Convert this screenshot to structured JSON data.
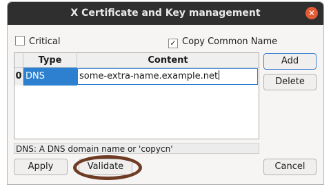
{
  "window": {
    "title": "X Certificate and Key management",
    "close_glyph": "✕"
  },
  "options": {
    "critical_label": "Critical",
    "critical_checked": false,
    "copycn_label": "Copy Common Name",
    "copycn_checked": true,
    "check_glyph": "✓"
  },
  "table": {
    "headers": [
      "Type",
      "Content"
    ],
    "rows": [
      {
        "index": "0",
        "type": "DNS",
        "content": "some-extra-name.example.net"
      }
    ]
  },
  "buttons": {
    "add": "Add",
    "delete": "Delete",
    "apply": "Apply",
    "validate": "Validate",
    "cancel": "Cancel"
  },
  "status": "DNS: A DNS domain name or 'copycn'",
  "colors": {
    "selection": "#2d7fd0",
    "annotation": "#6e3b24",
    "close": "#e25b35"
  }
}
